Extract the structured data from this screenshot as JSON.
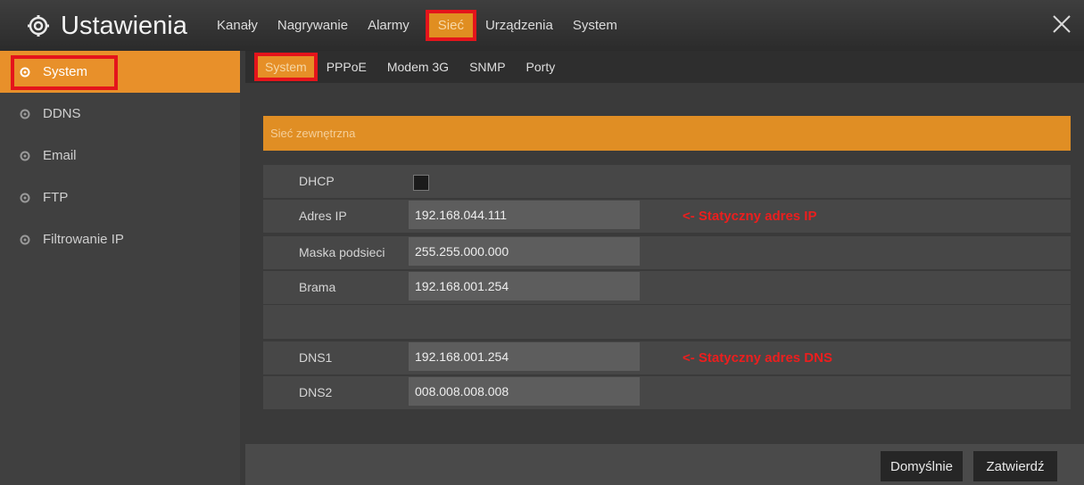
{
  "header": {
    "title": "Ustawienia",
    "menu": [
      "Kanały",
      "Nagrywanie",
      "Alarmy",
      "Sieć",
      "Urządzenia",
      "System"
    ],
    "active_menu": "Sieć"
  },
  "sidebar": {
    "items": [
      {
        "label": "System",
        "active": true
      },
      {
        "label": "DDNS"
      },
      {
        "label": "Email"
      },
      {
        "label": "FTP"
      },
      {
        "label": "Filtrowanie IP"
      }
    ]
  },
  "subtabs": [
    "System",
    "PPPoE",
    "Modem 3G",
    "SNMP",
    "Porty"
  ],
  "section": {
    "title": "Sieć zewnętrzna",
    "dhcp_label": "DHCP",
    "dhcp_checked": false,
    "ip_label": "Adres IP",
    "ip_value": "192.168.044.111",
    "mask_label": "Maska podsieci",
    "mask_value": "255.255.000.000",
    "gateway_label": "Brama",
    "gateway_value": "192.168.001.254",
    "dns1_label": "DNS1",
    "dns1_value": "192.168.001.254",
    "dns2_label": "DNS2",
    "dns2_value": "008.008.008.008",
    "note_ip": "<- Statyczny adres IP",
    "note_dns": "<- Statyczny adres DNS"
  },
  "buttons": {
    "default": "Domyślnie",
    "apply": "Zatwierdź"
  },
  "colors": {
    "accent": "#e08e24",
    "highlight": "#e4141b"
  }
}
